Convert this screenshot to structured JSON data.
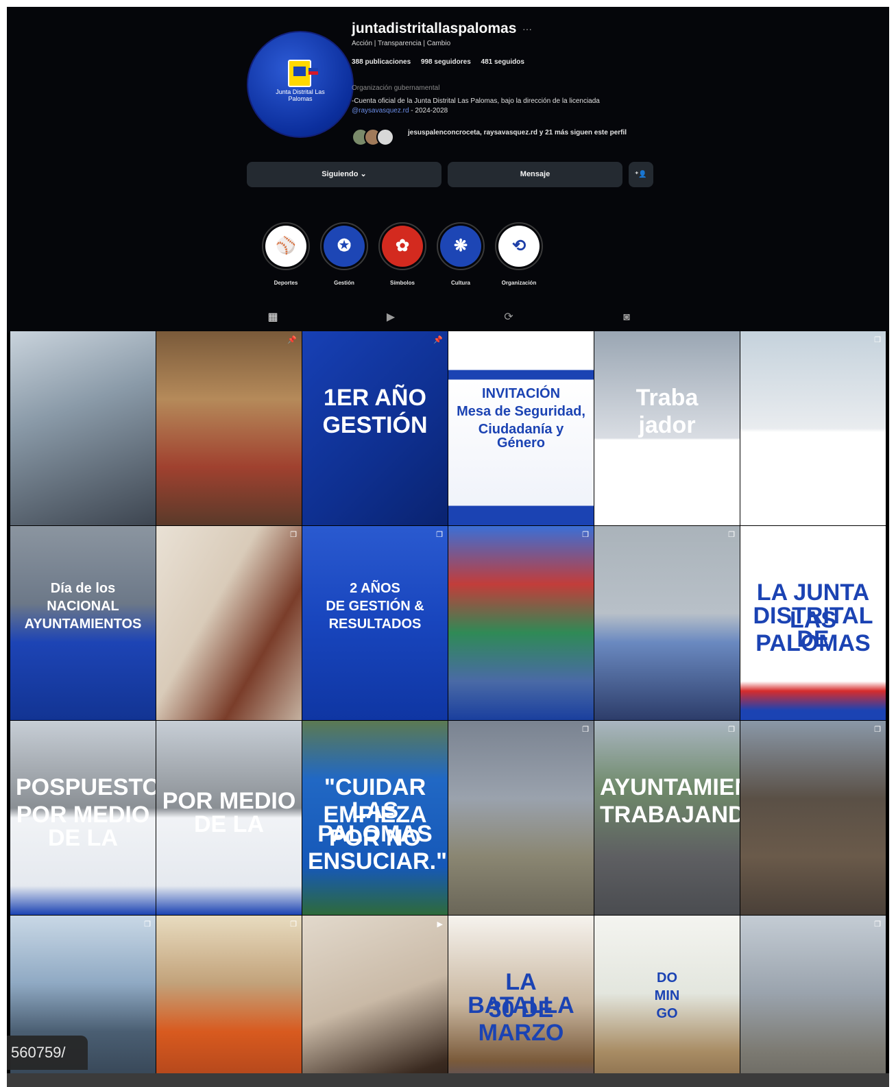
{
  "profile": {
    "username": "juntadistritallaspalomas",
    "more_glyph": "···",
    "tagline": "Acción | Transparencia | Cambio",
    "stats": {
      "posts": "388 publicaciones",
      "followers": "998 seguidores",
      "following": "481 seguidos"
    },
    "category": "Organización gubernamental",
    "bio": "-Cuenta oficial de la Junta Distrital Las Palomas, bajo la dirección de la licenciada",
    "bio_link": "@raysavasquez.rd",
    "bio_tail": " - 2024-2028",
    "followed_by": "jesuspalenconcroceta, raysavasquez.rd y 21 más siguen este perfil",
    "avatar_text": "Junta Distrital Las Palomas"
  },
  "actions": {
    "following": "Siguiendo ⌄",
    "message": "Mensaje",
    "add_user_glyph": "⁺👤"
  },
  "highlights": [
    {
      "label": "Deportes",
      "glyph": "⚾",
      "bg": "#ffffff",
      "fg": "#1d3fa8"
    },
    {
      "label": "Gestión",
      "glyph": "✪",
      "bg": "#1d46b5",
      "fg": "#ffffff"
    },
    {
      "label": "Símbolos",
      "glyph": "✿",
      "bg": "#d32a1f",
      "fg": "#ffffff"
    },
    {
      "label": "Cultura",
      "glyph": "❋",
      "bg": "#1d46b5",
      "fg": "#ffffff"
    },
    {
      "label": "Organización",
      "glyph": "⟲",
      "bg": "#ffffff",
      "fg": "#1d3fa8"
    }
  ],
  "tabs": [
    {
      "name": "posts",
      "glyph": "▦"
    },
    {
      "name": "reels",
      "glyph": "▶"
    },
    {
      "name": "reposts",
      "glyph": "⟳"
    },
    {
      "name": "tagged",
      "glyph": "◙"
    }
  ],
  "posts": [
    {
      "bg": "linear-gradient(160deg,#c9d3dc 0%,#8a9aa8 40%,#3d4550 100%)",
      "lines": [],
      "icon": ""
    },
    {
      "bg": "linear-gradient(180deg,#7a5a3a 0%,#b58a5a 35%,#a0412f 70%,#5a3a2a 100%)",
      "lines": [],
      "icon": "📌"
    },
    {
      "bg": "linear-gradient(135deg,#1740b5 0%,#0e2f8f 60%,#0a2370 100%)",
      "lines": [
        "1ER AÑO",
        "GESTIÓN"
      ],
      "icon": "📌"
    },
    {
      "bg": "linear-gradient(180deg,#ffffff 0%,#ffffff 20%,#1b43b3 20%,#1b43b3 25%,#ffffff 25%,#f0f3fa 90%,#1b43b3 90%)",
      "lines": [
        "INVITACIÓN",
        "Mesa de Seguridad,",
        "Ciudadanía y Género"
      ],
      "icon": ""
    },
    {
      "bg": "linear-gradient(180deg,#9aa6b3 0%,#d9dde3 55%,#ffffff 56%,#ffffff 100%)",
      "lines": [
        "Traba",
        "jador"
      ],
      "icon": ""
    },
    {
      "bg": "linear-gradient(180deg,#c5d2dc 0%,#e9ecef 50%,#ffffff 52%,#ffffff 100%)",
      "lines": [],
      "icon": "❐"
    },
    {
      "bg": "linear-gradient(180deg,#8b95a0 0%,#6c7888 40%,#1d44b5 60%,#123493 100%)",
      "lines": [
        "Día de los",
        "NACIONAL",
        "AYUNTAMIENTOS"
      ],
      "icon": ""
    },
    {
      "bg": "linear-gradient(120deg,#e9e1d5 0%,#d9cbb9 40%,#7a3d2a 70%,#c4b1a0 100%)",
      "lines": [],
      "icon": "❐"
    },
    {
      "bg": "linear-gradient(180deg,#2a5ad0 0%,#1845bd 50%,#0f36a3 100%)",
      "lines": [
        "2 AÑOS",
        "DE GESTIÓN &",
        "RESULTADOS"
      ],
      "icon": "❐"
    },
    {
      "bg": "linear-gradient(180deg,#3b6fd6 0%,#c23d3a 30%,#2f8a56 55%,#4a6aa6 80%,#1a3f9e 100%)",
      "lines": [],
      "icon": "❐"
    },
    {
      "bg": "linear-gradient(180deg,#aab3ba 0%,#b8c0c8 45%,#6a89c0 60%,#2d3d6a 100%)",
      "lines": [],
      "icon": "❐"
    },
    {
      "bg": "linear-gradient(180deg,#ffffff 0%,#ffffff 80%,#d62c2c 85%,#1b43b3 95%)",
      "lines": [
        "LA JUNTA DISTRITAL DE",
        "LAS PALOMAS"
      ],
      "icon": ""
    },
    {
      "bg": "linear-gradient(180deg,#c7ced6 0%,#8a8f94 45%,#f1f3f6 50%,#e5e9ef 85%,#1b43b3 100%)",
      "lines": [
        "POSPUESTO",
        "POR MEDIO DE LA"
      ],
      "icon": ""
    },
    {
      "bg": "linear-gradient(180deg,#c7ced6 0%,#8a8f94 45%,#f1f3f6 50%,#e5e9ef 85%,#1b43b3 100%)",
      "lines": [
        "POR MEDIO DE LA"
      ],
      "icon": ""
    },
    {
      "bg": "linear-gradient(180deg,#5c7a52 0%,#2168c4 30%,#1658b8 75%,#2e6a3a 100%)",
      "lines": [
        "\"CUIDAR LAS PALOMAS",
        "EMPIEZA POR NO ENSUCIAR.\""
      ],
      "icon": ""
    },
    {
      "bg": "linear-gradient(180deg,#7a8391 0%,#9aa2ad 40%,#8a8672 70%,#6a6658 100%)",
      "lines": [],
      "icon": "❐"
    },
    {
      "bg": "linear-gradient(180deg,#aab6c2 0%,#6f8a6a 35%,#5e5f62 70%,#4a4c50 100%)",
      "lines": [
        "AYUNTAMIENTO",
        "TRABAJANDO"
      ],
      "icon": "❐"
    },
    {
      "bg": "linear-gradient(180deg,#8a98a8 0%,#5a5046 40%,#6a5a4a 70%,#4a4038 100%)",
      "lines": [],
      "icon": "❐"
    },
    {
      "bg": "linear-gradient(180deg,#c9d8e6 0%,#8fa9c3 35%,#4a5e72 60%,#2a3644 100%)",
      "lines": [],
      "icon": "❐"
    },
    {
      "bg": "linear-gradient(180deg,#e8dcc0 0%,#c2a27a 35%,#d85a1f 60%,#9a3a1a 100%)",
      "lines": [],
      "icon": "❐"
    },
    {
      "bg": "linear-gradient(160deg,#e2d9cc 0%,#c9b9a6 45%,#3a2a20 80%,#1a120e 100%)",
      "lines": [],
      "icon": "▶"
    },
    {
      "bg": "linear-gradient(180deg,#f6f3ee 0%,#c9b7a0 45%,#7a5a3a 75%,#2a3f8a 100%)",
      "lines": [
        "LA BATALLA",
        "30 DE MARZO"
      ],
      "icon": ""
    },
    {
      "bg": "linear-gradient(180deg,#f4f4f0 0%,#e3e6de 40%,#a88c64 70%,#6e5437 100%)",
      "lines": [
        "DO",
        "MIN",
        "GO"
      ],
      "icon": ""
    },
    {
      "bg": "linear-gradient(180deg,#c4ccd4 0%,#9aa3ad 40%,#7c7a72 70%,#5c5a54 100%)",
      "lines": [],
      "icon": "❐"
    }
  ],
  "browser": {
    "url_fragment": "560759/"
  }
}
